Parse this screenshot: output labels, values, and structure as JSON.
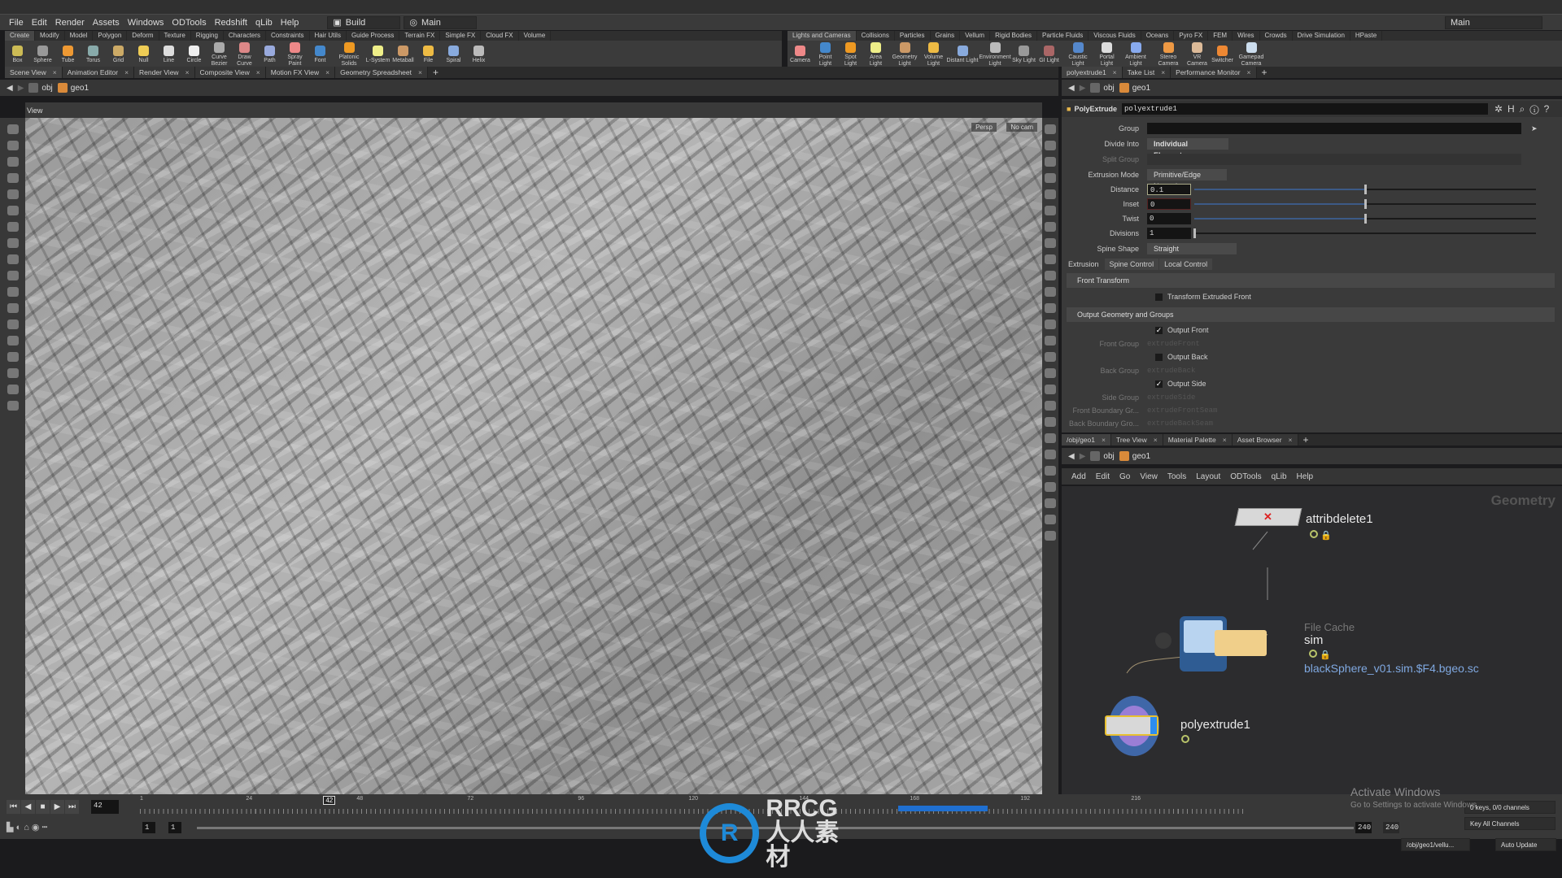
{
  "menubar": {
    "items": [
      "File",
      "Edit",
      "Render",
      "Assets",
      "Windows",
      "ODTools",
      "Redshift",
      "qLib",
      "Help"
    ],
    "desktop": "Build",
    "network_view": "Main",
    "right_desktop": "Main"
  },
  "shelf_left": {
    "tabs": [
      "Create",
      "Modify",
      "Model",
      "Polygon",
      "Deform",
      "Texture",
      "Rigging",
      "Characters",
      "Constraints",
      "Hair Utils",
      "Guide Process",
      "Terrain FX",
      "Simple FX",
      "Cloud FX",
      "Volume"
    ],
    "tools": [
      "Box",
      "Sphere",
      "Tube",
      "Torus",
      "Grid",
      "Null",
      "Line",
      "Circle",
      "Curve Bezier",
      "Draw Curve",
      "Path",
      "Spray Paint",
      "Font",
      "Platonic Solids",
      "L-System",
      "Metaball",
      "File",
      "Spiral",
      "Helix"
    ]
  },
  "shelf_right": {
    "tabs": [
      "Lights and Cameras",
      "Collisions",
      "Particles",
      "Grains",
      "Vellum",
      "Rigid Bodies",
      "Particle Fluids",
      "Viscous Fluids",
      "Oceans",
      "Pyro FX",
      "FEM",
      "Wires",
      "Crowds",
      "Drive Simulation",
      "HPaste"
    ],
    "tools": [
      "Camera",
      "Point Light",
      "Spot Light",
      "Area Light",
      "Geometry Light",
      "Volume Light",
      "Distant Light",
      "Environment Light",
      "Sky Light",
      "GI Light",
      "Caustic Light",
      "Portal Light",
      "Ambient Light",
      "Stereo Camera",
      "VR Camera",
      "Switcher",
      "Gamepad Camera"
    ]
  },
  "viewer": {
    "tabs": [
      "Scene View",
      "Animation Editor",
      "Render View",
      "Composite View",
      "Motion FX View",
      "Geometry Spreadsheet"
    ],
    "path": [
      "obj",
      "geo1"
    ],
    "view_label": "View",
    "persp": "Persp",
    "camera": "No cam"
  },
  "params_pane": {
    "tabs": [
      "polyextrude1",
      "Take List",
      "Performance Monitor"
    ],
    "path": [
      "obj",
      "geo1"
    ],
    "node_type": "PolyExtrude",
    "node_name": "polyextrude1",
    "group_label": "Group",
    "group_value": "",
    "divide_label": "Divide Into",
    "divide_value": "Individual Elements",
    "split_label": "Split Group",
    "mode_label": "Extrusion Mode",
    "mode_value": "Primitive/Edge Normal",
    "distance_label": "Distance",
    "distance_value": "0.1",
    "distance_slider": 0.5,
    "inset_label": "Inset",
    "inset_value": "0",
    "inset_slider": 0.5,
    "twist_label": "Twist",
    "twist_value": "0",
    "twist_slider": 0.5,
    "divisions_label": "Divisions",
    "divisions_value": "1",
    "divisions_slider": 0,
    "spine_label": "Spine Shape",
    "spine_value": "Straight",
    "subtabs": [
      "Extrusion",
      "Spine Control",
      "Local Control"
    ],
    "front_transform": "Front Transform",
    "transform_front": "Transform Extruded Front",
    "output_section": "Output Geometry and Groups",
    "output_front": "Output Front",
    "front_group": "Front Group",
    "front_group_ph": "extrudeFront",
    "output_back": "Output Back",
    "back_group": "Back Group",
    "back_group_ph": "extrudeBack",
    "output_side": "Output Side",
    "side_group": "Side Group",
    "side_group_ph": "extrudeSide",
    "front_boundary": "Front Boundary Gr...",
    "front_boundary_ph": "extrudeFrontSeam",
    "back_boundary": "Back Boundary Gro...",
    "back_boundary_ph": "extrudeBackSeam"
  },
  "network_pane": {
    "tabs": [
      "/obj/geo1",
      "Tree View",
      "Material Palette",
      "Asset Browser"
    ],
    "path": [
      "obj",
      "geo1"
    ],
    "menu": [
      "Add",
      "Edit",
      "Go",
      "View",
      "Tools",
      "Layout",
      "ODTools",
      "qLib",
      "Help"
    ],
    "context": "Geometry",
    "nodes": {
      "attribdelete": "attribdelete1",
      "filecache_type": "File Cache",
      "filecache": "sim",
      "filecache_path": "blackSphere_v01.sim.$F4.bgeo.sc",
      "polyextrude": "polyextrude1"
    }
  },
  "timeline": {
    "current_frame": "42",
    "start": "1",
    "start2": "1",
    "end": "240",
    "end2": "240",
    "ticks": [
      "1",
      "24",
      "48",
      "72",
      "96",
      "120",
      "144",
      "168",
      "192",
      "216"
    ],
    "keys_status": "0 keys, 0/0 channels",
    "key_all": "Key All Channels",
    "path": "/obj/geo1/vellu...",
    "update": "Auto Update"
  },
  "overlay": {
    "activate": "Activate Windows",
    "activate_sub": "Go to Settings to activate Windows.",
    "watermark": "RRCG 人人素材"
  },
  "colors": {
    "accent": "#3c6fd0",
    "node_yellow": "#f0cf8a",
    "link": "#7fa8e0"
  }
}
